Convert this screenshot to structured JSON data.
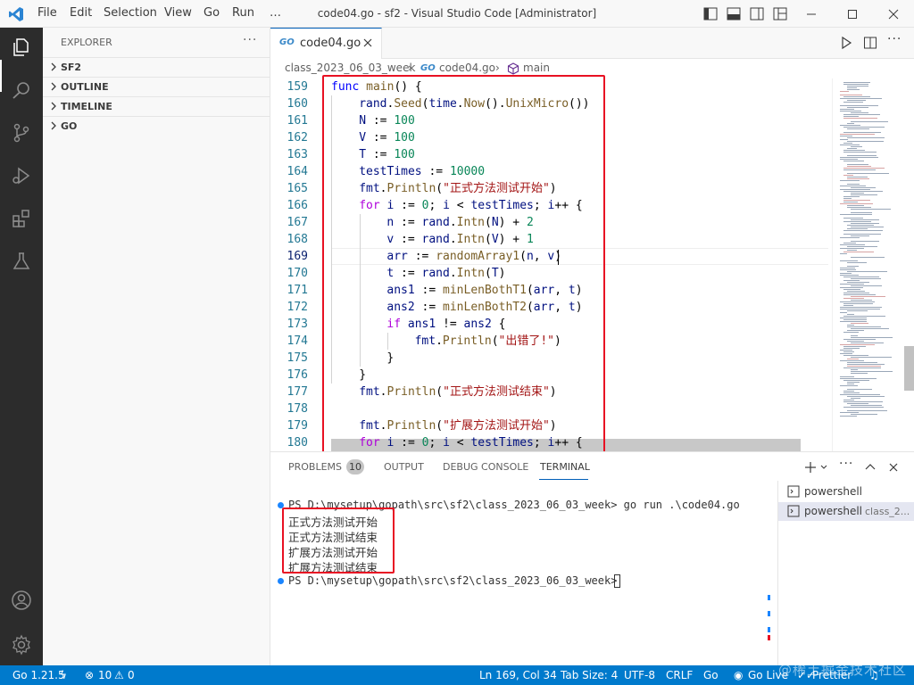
{
  "titlebar": {
    "menu": [
      "File",
      "Edit",
      "Selection",
      "View",
      "Go",
      "Run",
      "…"
    ],
    "title": "code04.go - sf2 - Visual Studio Code [Administrator]"
  },
  "sidebar": {
    "title": "EXPLORER",
    "more": "···",
    "sections": [
      "SF2",
      "OUTLINE",
      "TIMELINE",
      "GO"
    ]
  },
  "tabs": {
    "active": "code04.go",
    "icon_text": "GO"
  },
  "breadcrumb": {
    "folder": "class_2023_06_03_week",
    "file": "code04.go",
    "symbol": "main"
  },
  "editor": {
    "current_line": 169,
    "lines": [
      {
        "n": "159",
        "indent": 0,
        "tokens": [
          [
            "kw",
            "func "
          ],
          [
            "fn",
            "main"
          ],
          [
            "",
            "() {"
          ]
        ]
      },
      {
        "n": "160",
        "indent": 1,
        "tokens": [
          [
            "var",
            "rand"
          ],
          [
            "",
            "."
          ],
          [
            "fn",
            "Seed"
          ],
          [
            "",
            "("
          ],
          [
            "var",
            "time"
          ],
          [
            "",
            "."
          ],
          [
            "fn",
            "Now"
          ],
          [
            "",
            "()."
          ],
          [
            "fn",
            "UnixMicro"
          ],
          [
            "",
            "())"
          ]
        ]
      },
      {
        "n": "161",
        "indent": 1,
        "tokens": [
          [
            "var",
            "N"
          ],
          [
            "",
            " := "
          ],
          [
            "num",
            "100"
          ]
        ]
      },
      {
        "n": "162",
        "indent": 1,
        "tokens": [
          [
            "var",
            "V"
          ],
          [
            "",
            " := "
          ],
          [
            "num",
            "100"
          ]
        ]
      },
      {
        "n": "163",
        "indent": 1,
        "tokens": [
          [
            "var",
            "T"
          ],
          [
            "",
            " := "
          ],
          [
            "num",
            "100"
          ]
        ]
      },
      {
        "n": "164",
        "indent": 1,
        "tokens": [
          [
            "var",
            "testTimes"
          ],
          [
            "",
            " := "
          ],
          [
            "num",
            "10000"
          ]
        ]
      },
      {
        "n": "165",
        "indent": 1,
        "tokens": [
          [
            "var",
            "fmt"
          ],
          [
            "",
            "."
          ],
          [
            "fn",
            "Println"
          ],
          [
            "",
            "("
          ],
          [
            "str",
            "\"正式方法测试开始\""
          ],
          [
            "",
            ")"
          ]
        ]
      },
      {
        "n": "166",
        "indent": 1,
        "tokens": [
          [
            "ctl",
            "for "
          ],
          [
            "var",
            "i"
          ],
          [
            "",
            " := "
          ],
          [
            "num",
            "0"
          ],
          [
            "",
            "; "
          ],
          [
            "var",
            "i"
          ],
          [
            "",
            " < "
          ],
          [
            "var",
            "testTimes"
          ],
          [
            "",
            "; "
          ],
          [
            "var",
            "i"
          ],
          [
            "",
            "++ {"
          ]
        ]
      },
      {
        "n": "167",
        "indent": 2,
        "tokens": [
          [
            "var",
            "n"
          ],
          [
            "",
            " := "
          ],
          [
            "var",
            "rand"
          ],
          [
            "",
            "."
          ],
          [
            "fn",
            "Intn"
          ],
          [
            "",
            "("
          ],
          [
            "var",
            "N"
          ],
          [
            "",
            ") + "
          ],
          [
            "num",
            "2"
          ]
        ]
      },
      {
        "n": "168",
        "indent": 2,
        "tokens": [
          [
            "var",
            "v"
          ],
          [
            "",
            " := "
          ],
          [
            "var",
            "rand"
          ],
          [
            "",
            "."
          ],
          [
            "fn",
            "Intn"
          ],
          [
            "",
            "("
          ],
          [
            "var",
            "V"
          ],
          [
            "",
            ") + "
          ],
          [
            "num",
            "1"
          ]
        ]
      },
      {
        "n": "169",
        "indent": 2,
        "tokens": [
          [
            "var",
            "arr"
          ],
          [
            "",
            " := "
          ],
          [
            "fn",
            "randomArray1"
          ],
          [
            "",
            "("
          ],
          [
            "var",
            "n"
          ],
          [
            "",
            ", "
          ],
          [
            "var",
            "v"
          ],
          [
            "",
            ")"
          ]
        ]
      },
      {
        "n": "170",
        "indent": 2,
        "tokens": [
          [
            "var",
            "t"
          ],
          [
            "",
            " := "
          ],
          [
            "var",
            "rand"
          ],
          [
            "",
            "."
          ],
          [
            "fn",
            "Intn"
          ],
          [
            "",
            "("
          ],
          [
            "var",
            "T"
          ],
          [
            "",
            ")"
          ]
        ]
      },
      {
        "n": "171",
        "indent": 2,
        "tokens": [
          [
            "var",
            "ans1"
          ],
          [
            "",
            " := "
          ],
          [
            "fn",
            "minLenBothT1"
          ],
          [
            "",
            "("
          ],
          [
            "var",
            "arr"
          ],
          [
            "",
            ", "
          ],
          [
            "var",
            "t"
          ],
          [
            "",
            ")"
          ]
        ]
      },
      {
        "n": "172",
        "indent": 2,
        "tokens": [
          [
            "var",
            "ans2"
          ],
          [
            "",
            " := "
          ],
          [
            "fn",
            "minLenBothT2"
          ],
          [
            "",
            "("
          ],
          [
            "var",
            "arr"
          ],
          [
            "",
            ", "
          ],
          [
            "var",
            "t"
          ],
          [
            "",
            ")"
          ]
        ]
      },
      {
        "n": "173",
        "indent": 2,
        "tokens": [
          [
            "ctl",
            "if "
          ],
          [
            "var",
            "ans1"
          ],
          [
            "",
            " != "
          ],
          [
            "var",
            "ans2"
          ],
          [
            "",
            " {"
          ]
        ]
      },
      {
        "n": "174",
        "indent": 3,
        "tokens": [
          [
            "var",
            "fmt"
          ],
          [
            "",
            "."
          ],
          [
            "fn",
            "Println"
          ],
          [
            "",
            "("
          ],
          [
            "str",
            "\"出错了!\""
          ],
          [
            "",
            ")"
          ]
        ]
      },
      {
        "n": "175",
        "indent": 2,
        "tokens": [
          [
            "",
            "}"
          ]
        ]
      },
      {
        "n": "176",
        "indent": 1,
        "tokens": [
          [
            "",
            "}"
          ]
        ]
      },
      {
        "n": "177",
        "indent": 1,
        "tokens": [
          [
            "var",
            "fmt"
          ],
          [
            "",
            "."
          ],
          [
            "fn",
            "Println"
          ],
          [
            "",
            "("
          ],
          [
            "str",
            "\"正式方法测试结束\""
          ],
          [
            "",
            ")"
          ]
        ]
      },
      {
        "n": "178",
        "indent": 0,
        "tokens": []
      },
      {
        "n": "179",
        "indent": 1,
        "tokens": [
          [
            "var",
            "fmt"
          ],
          [
            "",
            "."
          ],
          [
            "fn",
            "Println"
          ],
          [
            "",
            "("
          ],
          [
            "str",
            "\"扩展方法测试开始\""
          ],
          [
            "",
            ")"
          ]
        ]
      },
      {
        "n": "180",
        "indent": 1,
        "tokens": [
          [
            "ctl",
            "for "
          ],
          [
            "var",
            "i"
          ],
          [
            "",
            " := "
          ],
          [
            "num",
            "0"
          ],
          [
            "",
            "; "
          ],
          [
            "var",
            "i"
          ],
          [
            "",
            " < "
          ],
          [
            "var",
            "testTimes"
          ],
          [
            "",
            "; "
          ],
          [
            "var",
            "i"
          ],
          [
            "",
            "++ {"
          ]
        ]
      }
    ]
  },
  "panel": {
    "tabs": [
      "PROBLEMS",
      "OUTPUT",
      "DEBUG CONSOLE",
      "TERMINAL"
    ],
    "problems_count": "10",
    "terminal": {
      "prompt_line": "PS D:\\mysetup\\gopath\\src\\sf2\\class_2023_06_03_week> go run .\\code04.go",
      "output": [
        "正式方法测试开始",
        "正式方法测试结束",
        "扩展方法测试开始",
        "扩展方法测试结束"
      ],
      "prompt_line2": "PS D:\\mysetup\\gopath\\src\\sf2\\class_2023_06_03_week> "
    },
    "terminal_list": [
      {
        "label": "powershell",
        "desc": ""
      },
      {
        "label": "powershell",
        "desc": "class_2..."
      }
    ]
  },
  "statusbar": {
    "go_version": "Go 1.21.5",
    "errors": "10",
    "warnings": "0",
    "position": "Ln 169, Col 34",
    "tab_size": "Tab Size: 4",
    "encoding": "UTF-8",
    "eol": "CRLF",
    "language": "Go",
    "go_live": "Go Live",
    "prettier": "Prettier"
  },
  "watermark": "@稀土掘金技术社区",
  "colors": {
    "accent": "#007acc",
    "activity_bar": "#2c2c2c",
    "highlight_box": "#e81123"
  }
}
